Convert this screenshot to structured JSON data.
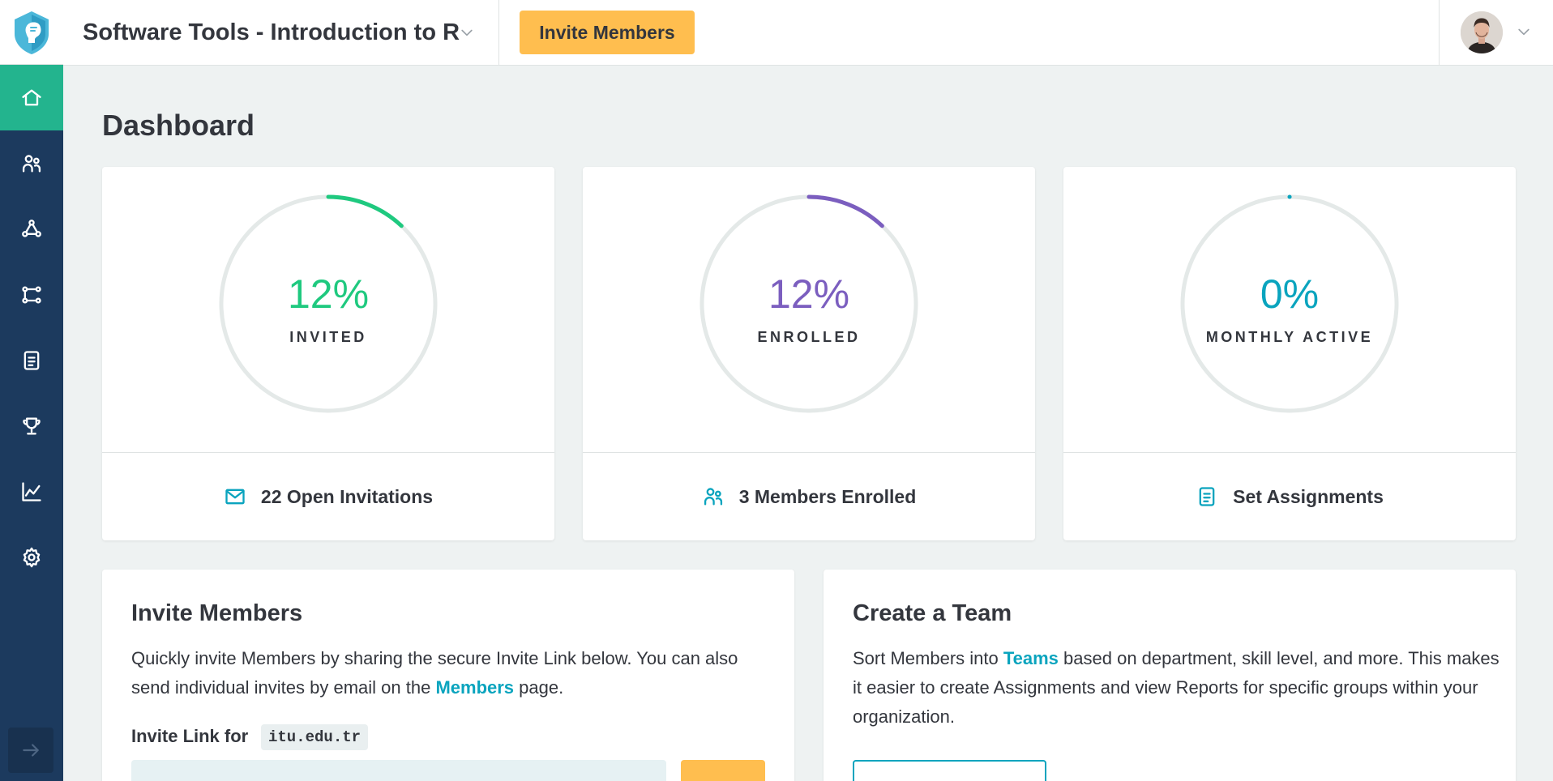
{
  "header": {
    "course_title": "Software Tools - Introduction to R",
    "invite_button": "Invite Members"
  },
  "sidebar": {
    "items": [
      {
        "icon": "home-icon",
        "active": true
      },
      {
        "icon": "users-icon",
        "active": false
      },
      {
        "icon": "network-icon",
        "active": false
      },
      {
        "icon": "tracks-icon",
        "active": false
      },
      {
        "icon": "assignments-icon",
        "active": false
      },
      {
        "icon": "trophy-icon",
        "active": false
      },
      {
        "icon": "chart-line-icon",
        "active": false
      },
      {
        "icon": "gear-icon",
        "active": false
      }
    ],
    "collapse_icon": "arrow-right-icon"
  },
  "main": {
    "title": "Dashboard",
    "stats": [
      {
        "percent": "12%",
        "value": 0.12,
        "label": "INVITED",
        "color": "#1fc97f",
        "footer_icon": "mail-icon",
        "footer_text": "22 Open Invitations"
      },
      {
        "percent": "12%",
        "value": 0.12,
        "label": "ENROLLED",
        "color": "#7b5ebf",
        "footer_icon": "users-icon",
        "footer_text": "3 Members Enrolled"
      },
      {
        "percent": "0%",
        "value": 0.0,
        "label": "MONTHLY ACTIVE",
        "color": "#0aa4be",
        "footer_icon": "assignment-icon",
        "footer_text": "Set Assignments"
      }
    ],
    "invite_card": {
      "title": "Invite Members",
      "text_before": "Quickly invite Members by sharing the secure Invite Link below. You can also send individual invites by email on the ",
      "link": "Members",
      "text_after": " page.",
      "invite_link_label": "Invite Link for",
      "domain": "itu.edu.tr"
    },
    "team_card": {
      "title": "Create a Team",
      "text_before": "Sort Members into ",
      "link": "Teams",
      "text_after": " based on department, skill level, and more. This makes it easier to create Assignments and view Reports for specific groups within your organization."
    }
  },
  "colors": {
    "accent_green": "#23b48e",
    "sidebar": "#1c3a5e",
    "button_yellow": "#ffbe4f",
    "link_teal": "#0aa4be"
  }
}
